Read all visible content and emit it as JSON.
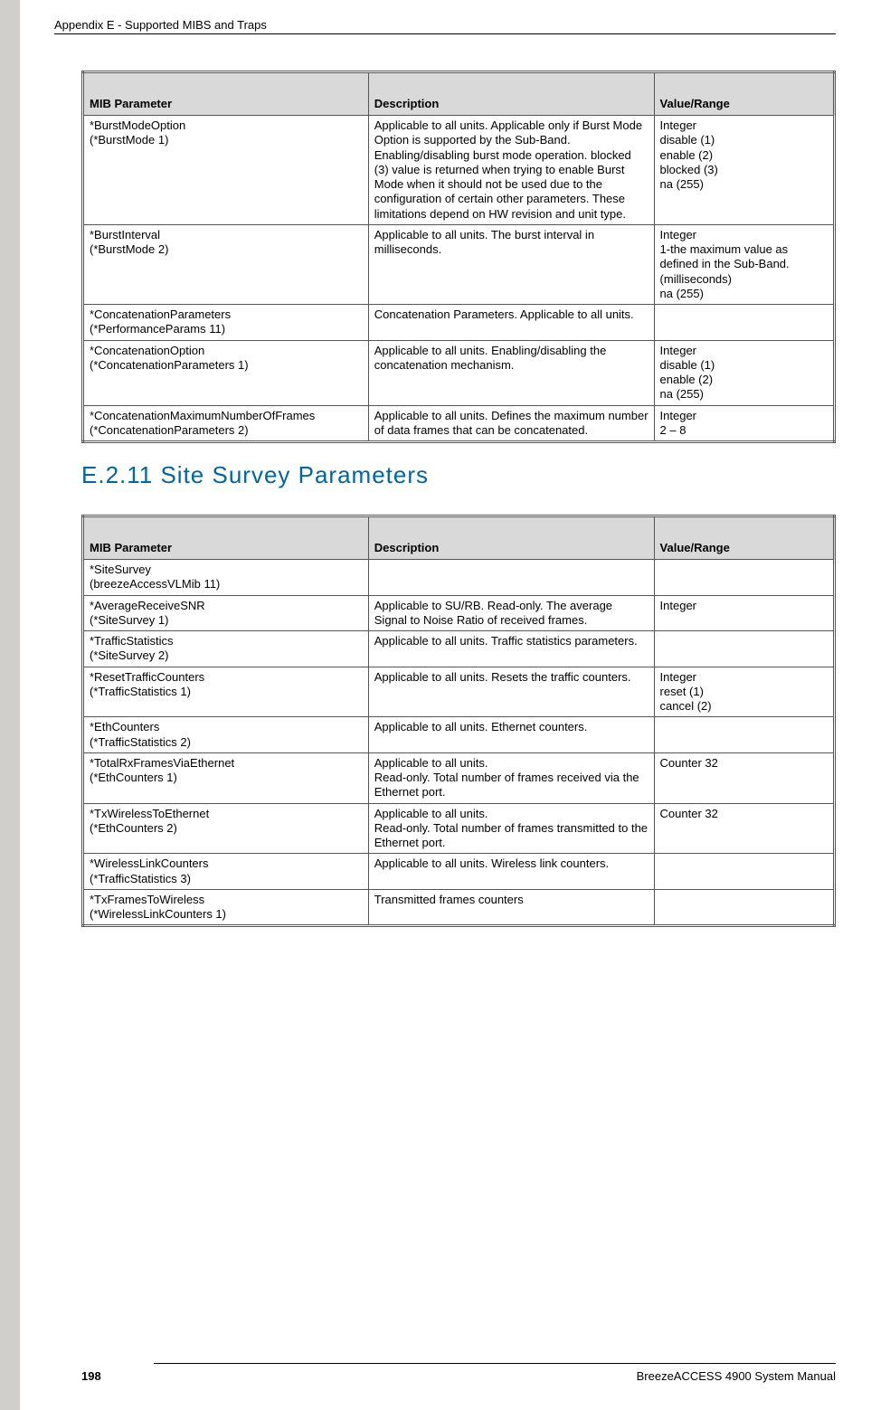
{
  "header": {
    "title": "Appendix E - Supported MIBS and Traps"
  },
  "table1": {
    "headers": {
      "c1": "MIB Parameter",
      "c2": "Description",
      "c3": "Value/Range"
    },
    "rows": [
      {
        "param": "*BurstModeOption\n(*BurstMode 1)",
        "desc": "Applicable to all units. Applicable only if Burst Mode Option is supported by the Sub-Band. Enabling/disabling burst mode operation. blocked (3) value is returned when trying to enable Burst Mode when it should not be used due to the configuration of certain other parameters. These limitations depend on HW revision and unit type.",
        "range": "Integer\ndisable (1)\nenable (2)\nblocked (3)\nna (255)"
      },
      {
        "param": "*BurstInterval\n(*BurstMode 2)",
        "desc": "Applicable to all units. The burst interval in milliseconds.",
        "range": "Integer\n1-the maximum value as defined in the Sub-Band. (milliseconds)\nna (255)"
      },
      {
        "param": "*ConcatenationParameters\n(*PerformanceParams 11)",
        "desc": "Concatenation Parameters. Applicable to all units.",
        "range": ""
      },
      {
        "param": "*ConcatenationOption\n(*ConcatenationParameters 1)",
        "desc": "Applicable to all units. Enabling/disabling the concatenation mechanism.",
        "range": "Integer\ndisable (1)\nenable (2)\nna (255)"
      },
      {
        "param": "*ConcatenationMaximumNumberOfFrames\n(*ConcatenationParameters 2)",
        "desc": "Applicable to all units. Defines the maximum number of data frames that can be concatenated.",
        "range": "Integer\n2 – 8"
      }
    ]
  },
  "section_heading": "E.2.11  Site Survey Parameters",
  "table2": {
    "headers": {
      "c1": "MIB Parameter",
      "c2": "Description",
      "c3": "Value/Range"
    },
    "rows": [
      {
        "param": "*SiteSurvey\n(breezeAccessVLMib 11)",
        "desc": "",
        "range": ""
      },
      {
        "param": "*AverageReceiveSNR\n(*SiteSurvey 1)",
        "desc": "Applicable to SU/RB. Read-only. The average Signal to Noise Ratio of received frames.",
        "range": "Integer"
      },
      {
        "param": "*TrafficStatistics\n(*SiteSurvey 2)",
        "desc": "Applicable to all units. Traffic statistics parameters.",
        "range": ""
      },
      {
        "param": "*ResetTrafficCounters\n(*TrafficStatistics 1)",
        "desc": "Applicable to all units. Resets the traffic counters.",
        "range": "Integer\nreset (1)\ncancel (2)"
      },
      {
        "param": "*EthCounters\n(*TrafficStatistics 2)",
        "desc": "Applicable to all units. Ethernet counters.",
        "range": ""
      },
      {
        "param": "*TotalRxFramesViaEthernet\n(*EthCounters 1)",
        "desc": "Applicable to all units.\nRead-only. Total number of frames received via the Ethernet port.",
        "range": "Counter 32"
      },
      {
        "param": "*TxWirelessToEthernet\n(*EthCounters 2)",
        "desc": "Applicable to all units.\nRead-only. Total number of frames transmitted to the Ethernet port.",
        "range": "Counter 32"
      },
      {
        "param": "*WirelessLinkCounters\n(*TrafficStatistics 3)",
        "desc": "Applicable to all units. Wireless link counters.",
        "range": ""
      },
      {
        "param": "*TxFramesToWireless\n(*WirelessLinkCounters 1)",
        "desc": "Transmitted frames counters",
        "range": ""
      }
    ]
  },
  "footer": {
    "manual": "BreezeACCESS 4900 System Manual",
    "page": "198"
  }
}
